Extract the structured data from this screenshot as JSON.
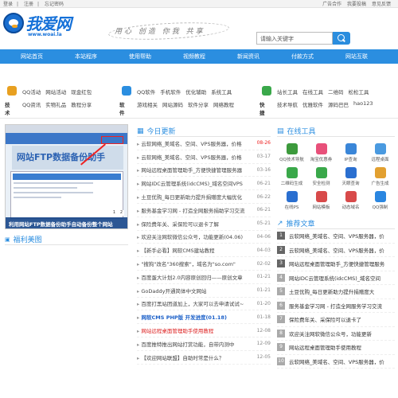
{
  "topbar": {
    "left": [
      "登录",
      "注册",
      "忘记密码"
    ],
    "right": [
      "广告合作",
      "我要投稿",
      "意见反馈"
    ]
  },
  "logo": {
    "name": "我爱网",
    "site": "www.woai.la"
  },
  "slogan": "用心 创造 你我 共享",
  "search": {
    "placeholder": "请输入关键字"
  },
  "nav": [
    "网站首页",
    "本站程序",
    "使用帮助",
    "视频教程",
    "新闻资讯",
    "付款方式",
    "网站互联"
  ],
  "link_groups": [
    {
      "name": "技术",
      "icon_color": "#e8a020",
      "row1": [
        "QQ活动",
        "网站活动",
        "现金红包"
      ],
      "row2": [
        "QQ资讯",
        "实物礼品",
        "教程分享"
      ]
    },
    {
      "name": "软件",
      "icon_color": "#2b8ee0",
      "row1": [
        "QQ软件",
        "手机软件",
        "优化辅助",
        "系统工具"
      ],
      "row2": [
        "游戏相关",
        "网站源码",
        "软件分享",
        "网络教程"
      ]
    },
    {
      "name": "快捷",
      "icon_color": "#3aa84a",
      "row1": [
        "站长工具",
        "在线工具",
        "二维码",
        "松松工具"
      ],
      "row2": [
        "技术导航",
        "优雅软件",
        "源码巴巴",
        "hao123"
      ]
    }
  ],
  "slideshow": {
    "big_text": "网站FTP数据备份助手",
    "caption": "利用网站FTP数据备份助手自动备份整个网站",
    "pages": [
      "1",
      "2"
    ]
  },
  "today": {
    "title": "今日更新",
    "items": [
      {
        "title": "云软网络_美域名、空间、VPS服务器，价格",
        "date": "08-26",
        "hot": true
      },
      {
        "title": "云软网络_美域名、空间、VPS服务器，价格",
        "date": "03-17"
      },
      {
        "title": "网站远程桌面管理助手_方便快捷管理服务器",
        "date": "03-16"
      },
      {
        "title": "网站IDC云管理系统(idcCMS)_域名空间VPS",
        "date": "06-21"
      },
      {
        "title": "土豆优购_每日更新助力提升捐赠度大幅优化",
        "date": "06-22"
      },
      {
        "title": "服务基金学习网 - 打造全网服务捐助学习交流",
        "date": "06-21"
      },
      {
        "title": "保险费年关、采保险可以退卡了解",
        "date": "05-21"
      },
      {
        "title": "欢迎关注网软微信公众号，功能更新(04.06)",
        "date": "04-06"
      },
      {
        "title": "【新手必看】网软CMS建站教程",
        "date": "04-03"
      },
      {
        "title": "\"搜狗\"改名\"360搜索\"，域名为\"so.com\"",
        "date": "02-02"
      },
      {
        "title": "百度蛋大计划2.0内容原创回归——原创文章",
        "date": "01-21"
      },
      {
        "title": "GoDaddy开通简体中文网站",
        "date": "01-21"
      },
      {
        "title": "百度打黑站团道加上，大家可以去申请试试~",
        "date": "01-20"
      },
      {
        "title": "网软CMS PHP版 开发进度(01.18)",
        "date": "01-18",
        "blue": true
      },
      {
        "title": "网站远程桌面管理助手使用教程",
        "date": "12-08",
        "red": true
      },
      {
        "title": "百度推特推出网站打赏功能，自带内测中",
        "date": "12-09"
      },
      {
        "title": "【欢迎网站联盟】自助时常是什么？",
        "date": "12-05"
      }
    ]
  },
  "tools": {
    "title": "在线工具",
    "items": [
      {
        "label": "QQ技术导航",
        "color": "#3c9a3c"
      },
      {
        "label": "淘宝优惠券",
        "color": "#e8507a"
      },
      {
        "label": "IP查询",
        "color": "#3a86d8"
      },
      {
        "label": "远程桌面",
        "color": "#4a9ae0"
      },
      {
        "label": "二维码生成",
        "color": "#3aa84a"
      },
      {
        "label": "安全检测",
        "color": "#3aa84a"
      },
      {
        "label": "天眼查询",
        "color": "#2a6fd0"
      },
      {
        "label": "广告生成",
        "color": "#e2a030"
      },
      {
        "label": "在线PS",
        "color": "#2a6fd0"
      },
      {
        "label": "网站模板",
        "color": "#d84a4a"
      },
      {
        "label": "动态域名",
        "color": "#d84a4a"
      },
      {
        "label": "QQ强制",
        "color": "#2a86e0"
      }
    ]
  },
  "recommend": {
    "title": "推荐文章",
    "items": [
      "云软网络_美域名、空间、VPS服务器，价",
      "云软网络_美域名、空间、VPS服务器，价",
      "网站远程桌面管理助手_方便快捷管理服务",
      "网站IDC云管理系统(idcCMS)_域名空间",
      "土豆优购_每日更新助力提升捐赠度大",
      "服务基金学习网 - 打造全网服务学习交流",
      "保险费年关、采保险可以退卡了",
      "欢迎关注网软微信公众号，功能更新",
      "网站远程桌面管理助手使用教程",
      "云软网络_美域名、空间、VPS服务器，价"
    ]
  },
  "photo_section": {
    "title": "福利美图"
  }
}
